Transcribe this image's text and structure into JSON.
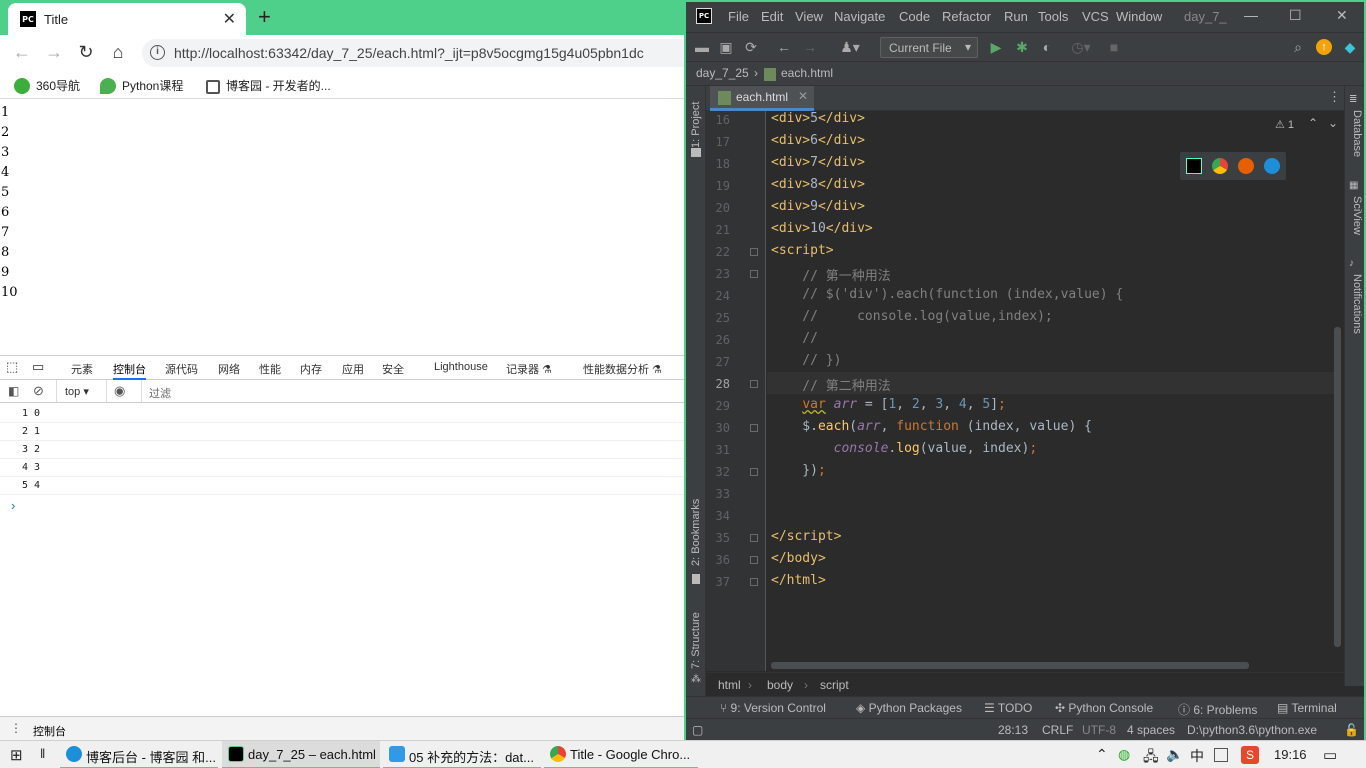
{
  "chrome": {
    "tab_title": "Title",
    "tab_favicon_text": "PC",
    "url": "http://localhost:63342/day_7_25/each.html?_ijt=p8v5ocgmg15g4u05pbn1dc",
    "bookmarks": [
      "360导航",
      "Python课程",
      "博客园 - 开发者的..."
    ],
    "page_lines": [
      "1",
      "2",
      "3",
      "4",
      "5",
      "6",
      "7",
      "8",
      "9",
      "10"
    ],
    "devtools": {
      "tabs": [
        "元素",
        "控制台",
        "源代码",
        "网络",
        "性能",
        "内存",
        "应用",
        "安全",
        "Lighthouse",
        "记录器 ⚗",
        "性能数据分析 ⚗"
      ],
      "active_tab": "控制台",
      "context": "top",
      "filter_placeholder": "过滤",
      "console_rows": [
        "1 0",
        "2 1",
        "3 2",
        "4 3",
        "5 4"
      ],
      "prompt": "›",
      "drawer_label": "控制台"
    }
  },
  "ide": {
    "logo_text": "PC",
    "menu": [
      "File",
      "Edit",
      "View",
      "Navigate",
      "Code",
      "Refactor",
      "Run",
      "Tools",
      "VCS",
      "Window",
      "day_7_"
    ],
    "run_config": "Current File",
    "breadcrumb_project": "day_7_25",
    "breadcrumb_file": "each.html",
    "editor_tab": "each.html",
    "warnings": "⚠ 1",
    "left_panels": [
      "1: Project",
      "2: Bookmarks",
      "7: Structure"
    ],
    "right_panels": [
      "Database",
      "SciView",
      "Notifications"
    ],
    "line_numbers": [
      "16",
      "17",
      "18",
      "19",
      "20",
      "21",
      "22",
      "23",
      "24",
      "25",
      "26",
      "27",
      "28",
      "29",
      "30",
      "31",
      "32",
      "33",
      "34",
      "35",
      "36",
      "37"
    ],
    "current_line": "28",
    "code_crumbs": [
      "html",
      "body",
      "script"
    ],
    "tool_tabs": [
      "9: Version Control",
      "Python Packages",
      "TODO",
      "Python Console",
      "6: Problems",
      "Terminal"
    ],
    "status": {
      "position": "28:13",
      "line_sep": "CRLF",
      "encoding": "UTF-8",
      "indent": "4 spaces",
      "interpreter": "D:\\python3.6\\python.exe"
    }
  },
  "taskbar": {
    "tasks": [
      "博客后台 - 博客园 和...",
      "day_7_25 – each.html",
      "05 补充的方法：dat...",
      "Title - Google Chro..."
    ],
    "time": "19:16",
    "ime": "中"
  }
}
